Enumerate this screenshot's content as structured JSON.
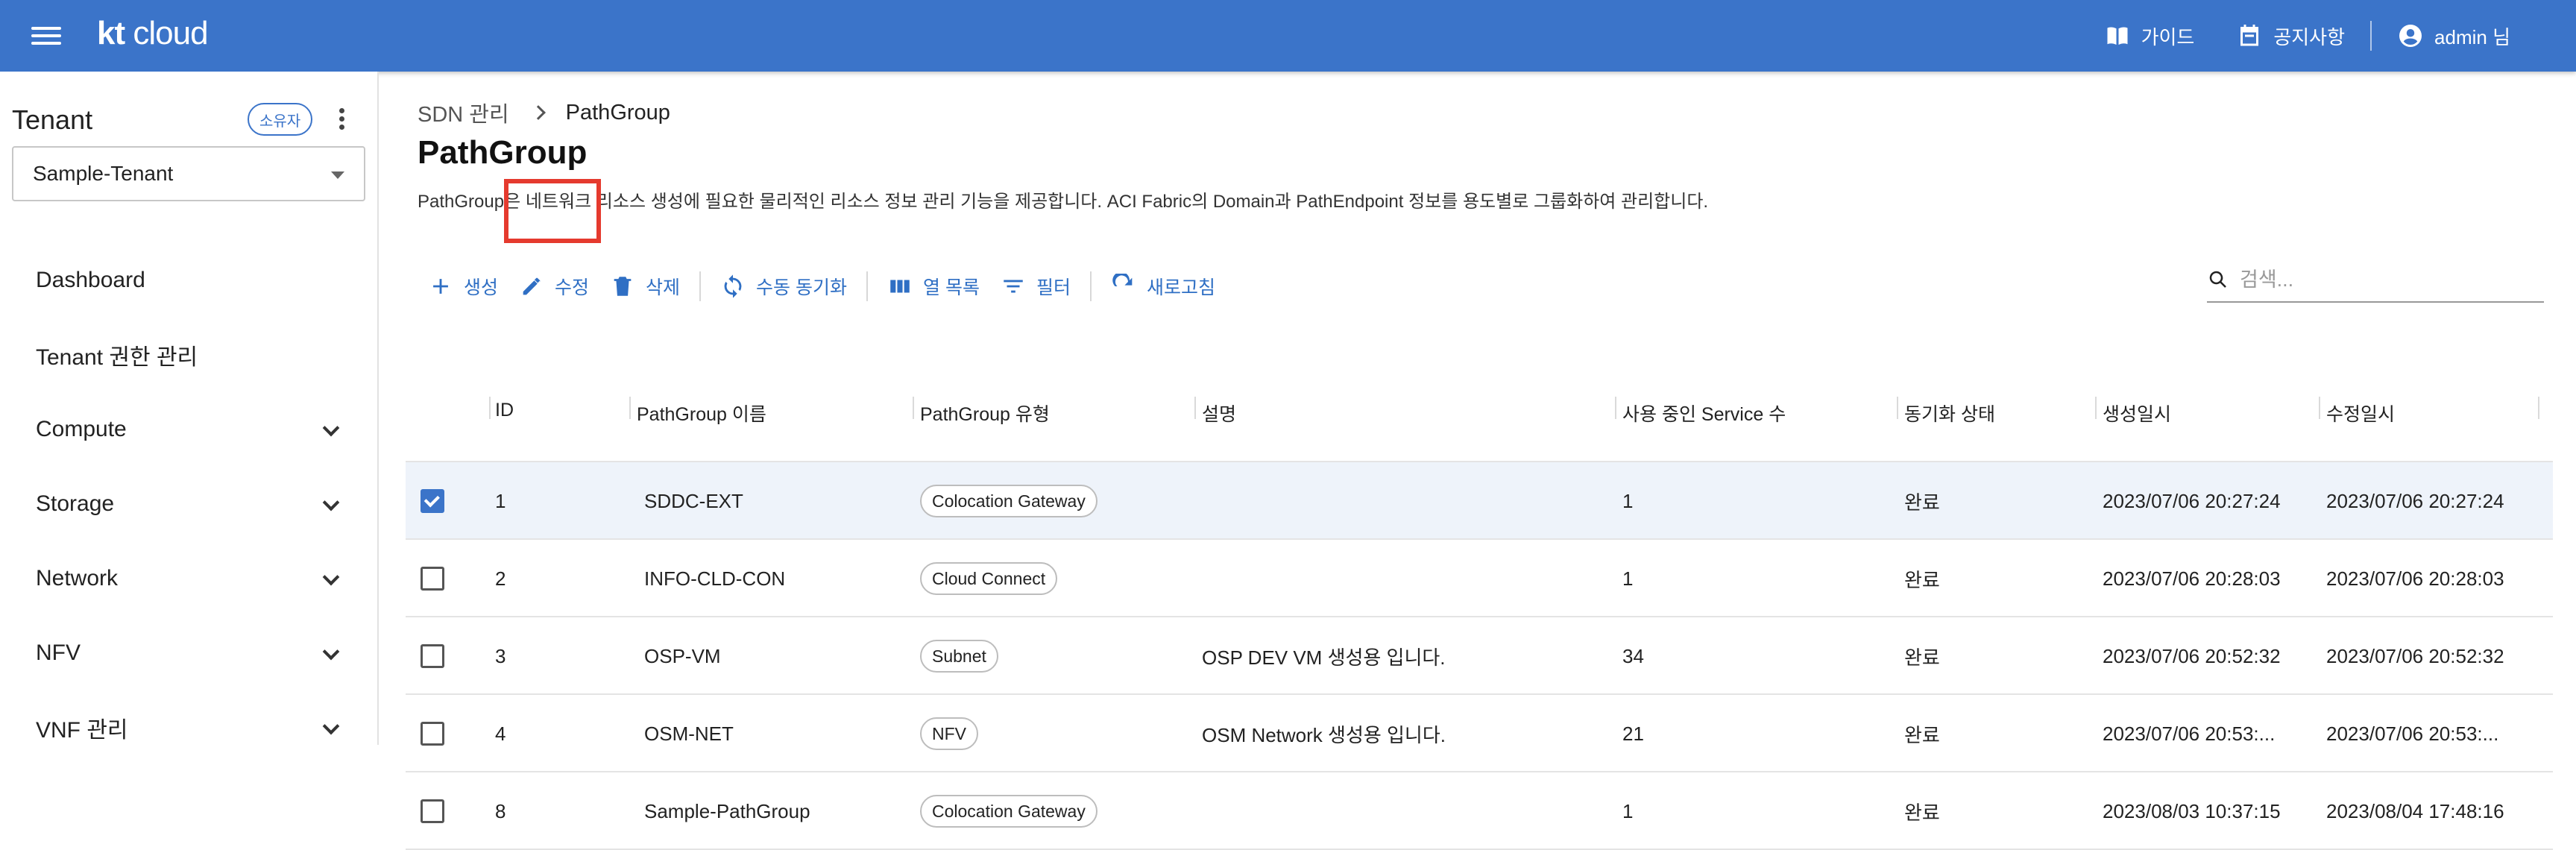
{
  "appbar": {
    "logo_kt": "kt",
    "logo_cloud": "cloud",
    "guide_label": "가이드",
    "notice_label": "공지사항",
    "user_label": "admin 님",
    "icons": {
      "menu": "hamburger-icon",
      "guide": "book-icon",
      "notice": "calendar-icon",
      "user": "account-circle-icon"
    }
  },
  "sidebar": {
    "tenant_title": "Tenant",
    "owner_badge": "소유자",
    "tenant_selected": "Sample-Tenant",
    "items": [
      {
        "label": "Dashboard",
        "expandable": false
      },
      {
        "label": "Tenant 권한 관리",
        "expandable": false
      },
      {
        "label": "Compute",
        "expandable": true
      },
      {
        "label": "Storage",
        "expandable": true
      },
      {
        "label": "Network",
        "expandable": true
      },
      {
        "label": "NFV",
        "expandable": true
      },
      {
        "label": "VNF 관리",
        "expandable": true
      }
    ]
  },
  "main": {
    "breadcrumb": {
      "parent": "SDN 관리",
      "current": "PathGroup"
    },
    "title": "PathGroup",
    "description": "PathGroup은 네트워크 리소스 생성에 필요한 물리적인 리소스 정보 관리 기능을 제공합니다. ACI Fabric의 Domain과 PathEndpoint 정보를 용도별로 그룹화하여 관리합니다.",
    "toolbar": {
      "create": "생성",
      "edit": "수정",
      "delete": "삭제",
      "sync": "수동 동기화",
      "columns": "열 목록",
      "filter": "필터",
      "refresh": "새로고침"
    },
    "search_placeholder": "검색...",
    "accent_color": "#3b74c9",
    "highlight_color": "#e53a2e"
  },
  "table": {
    "headers": [
      "ID",
      "PathGroup 이름",
      "PathGroup 유형",
      "설명",
      "사용 중인 Service 수",
      "동기화 상태",
      "생성일시",
      "수정일시"
    ],
    "rows": [
      {
        "checked": true,
        "id": "1",
        "name": "SDDC-EXT",
        "type": "Colocation Gateway",
        "desc": "",
        "services": "1",
        "sync": "완료",
        "created": "2023/07/06 20:27:24",
        "updated": "2023/07/06 20:27:24"
      },
      {
        "checked": false,
        "id": "2",
        "name": "INFO-CLD-CON",
        "type": "Cloud Connect",
        "desc": "",
        "services": "1",
        "sync": "완료",
        "created": "2023/07/06 20:28:03",
        "updated": "2023/07/06 20:28:03"
      },
      {
        "checked": false,
        "id": "3",
        "name": "OSP-VM",
        "type": "Subnet",
        "desc": "OSP DEV VM 생성용 입니다.",
        "services": "34",
        "sync": "완료",
        "created": "2023/07/06 20:52:32",
        "updated": "2023/07/06 20:52:32"
      },
      {
        "checked": false,
        "id": "4",
        "name": "OSM-NET",
        "type": "NFV",
        "desc": "OSM Network 생성용 입니다.",
        "services": "21",
        "sync": "완료",
        "created": "2023/07/06 20:53:...",
        "updated": "2023/07/06 20:53:..."
      },
      {
        "checked": false,
        "id": "8",
        "name": "Sample-PathGroup",
        "type": "Colocation Gateway",
        "desc": "",
        "services": "1",
        "sync": "완료",
        "created": "2023/08/03 10:37:15",
        "updated": "2023/08/04 17:48:16"
      }
    ]
  }
}
